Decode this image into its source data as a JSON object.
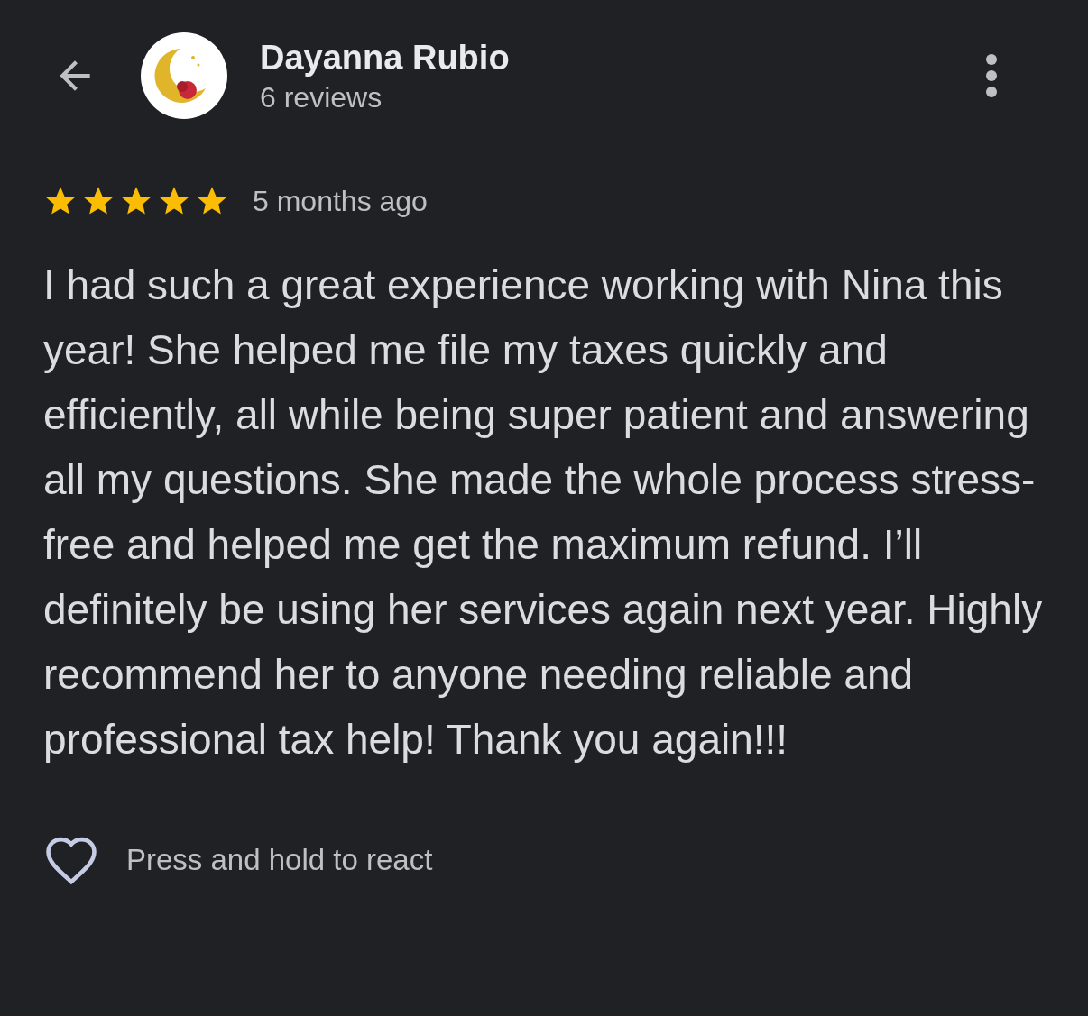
{
  "header": {
    "name": "Dayanna Rubio",
    "reviews": "6 reviews"
  },
  "review": {
    "stars": 5,
    "time": "5 months ago",
    "text": "I had such a great experience working with Nina this year! She helped me file my taxes quickly and efficiently, all while being super patient and answering all my questions. She made the whole process stress-free and helped me get the maximum refund. I’ll definitely be using her services again next year. Highly recommend her to anyone needing reliable and professional tax help! Thank you again!!!"
  },
  "react": {
    "label": "Press and hold to react"
  }
}
